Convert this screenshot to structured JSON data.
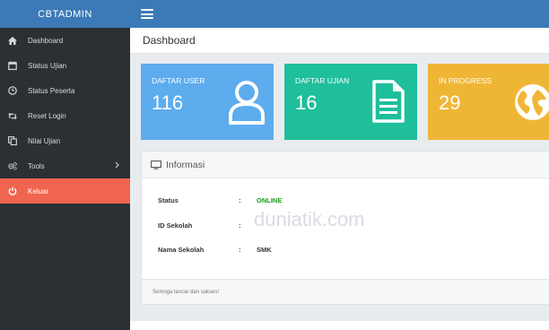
{
  "brand": "CBTADMIN",
  "sidebar": {
    "items": [
      {
        "label": "Dashboard",
        "icon": "home-icon"
      },
      {
        "label": "Status Ujian",
        "icon": "calendar-icon"
      },
      {
        "label": "Status Peserta",
        "icon": "clock-icon"
      },
      {
        "label": "Reset Login",
        "icon": "retweet-icon"
      },
      {
        "label": "Nilai Ujian",
        "icon": "copy-icon"
      },
      {
        "label": "Tools",
        "icon": "gears-icon"
      },
      {
        "label": "Keluar",
        "icon": "power-icon"
      }
    ]
  },
  "page": {
    "title": "Dashboard"
  },
  "stats": [
    {
      "label": "DAFTAR USER",
      "value": "116",
      "icon": "user-icon",
      "color": "#5dacee"
    },
    {
      "label": "DAFTAR UJIAN",
      "value": "16",
      "icon": "document-icon",
      "color": "#1fbf9b"
    },
    {
      "label": "IN PROGRESS",
      "value": "29",
      "icon": "globe-icon",
      "color": "#efb636"
    }
  ],
  "info": {
    "title": "Informasi",
    "rows": [
      {
        "key": "Status",
        "sep": ":",
        "value": "ONLINE",
        "value_color": "#1a9c1a"
      },
      {
        "key": "ID Sekolah",
        "sep": ":",
        "value": ""
      },
      {
        "key": "Nama Sekolah",
        "sep": ":",
        "value": "SMK"
      }
    ],
    "footer": "Semoga lancar dan sukses!"
  },
  "watermark": "duniatik.com",
  "colors": {
    "topbar": "#3c7ab7",
    "sidebar": "#2b3035",
    "active": "#f0654f"
  }
}
